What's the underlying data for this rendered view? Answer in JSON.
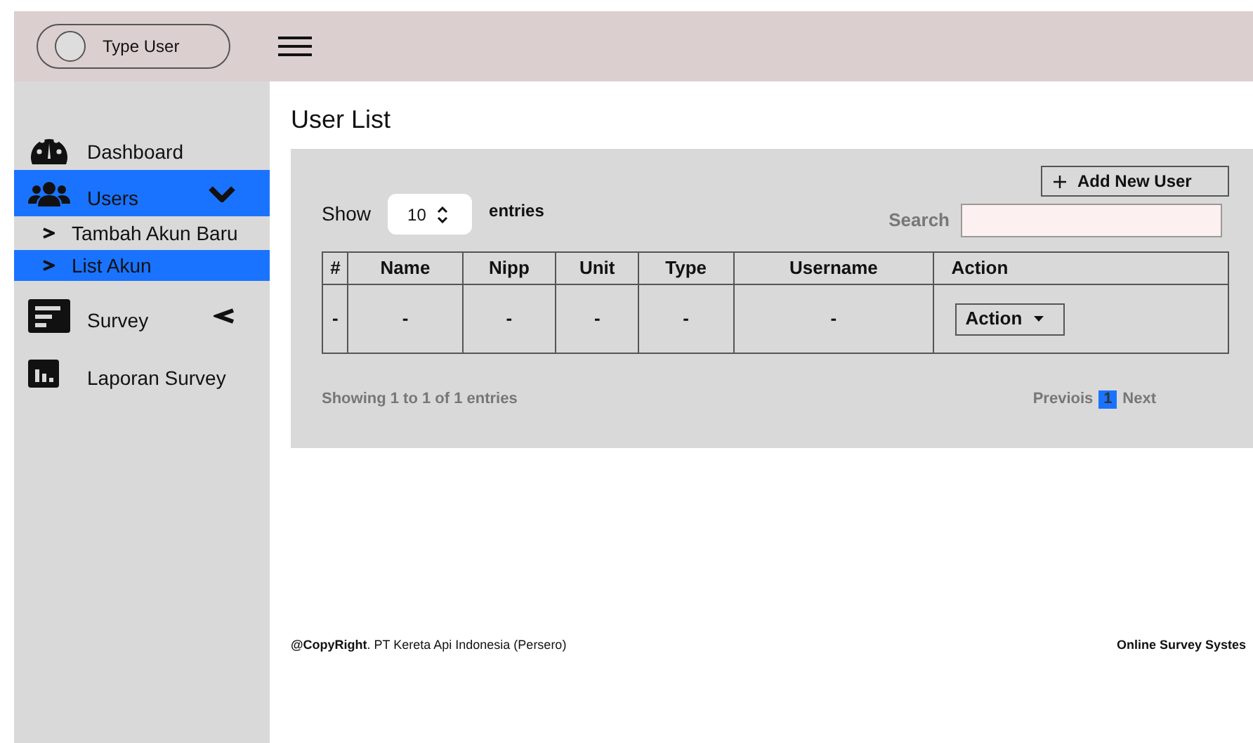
{
  "header": {
    "user_label": "Type User"
  },
  "sidebar": {
    "items": [
      {
        "label": "Dashboard",
        "kind": "dashboard",
        "selected": false
      },
      {
        "label": "Users",
        "kind": "users",
        "selected": true,
        "expanded": true,
        "children": [
          {
            "label": "Tambah Akun Baru",
            "selected": false
          },
          {
            "label": "List Akun",
            "selected": true
          }
        ]
      },
      {
        "label": "Survey",
        "kind": "survey",
        "selected": false,
        "expanded": false
      },
      {
        "label": "Laporan Survey",
        "kind": "report",
        "selected": false
      }
    ]
  },
  "page_title": "User List",
  "add_button": "Add New User",
  "show": {
    "label": "Show",
    "value": "10",
    "suffix": "entries"
  },
  "search": {
    "label": "Search"
  },
  "table": {
    "columns": [
      "#",
      "Name",
      "Nipp",
      "Unit",
      "Type",
      "Username",
      "Action"
    ],
    "rows": [
      {
        "cells": [
          "-",
          "-",
          "-",
          "-",
          "-",
          "-"
        ],
        "action": "Action"
      }
    ]
  },
  "info": "Showing 1 to 1 of 1 entries",
  "pagination": {
    "previous": "Previois",
    "pages": [
      {
        "label": "1",
        "selected": true
      }
    ],
    "next": "Next"
  },
  "footer": {
    "copyright": "**@CopyRight**. PT Kereta Api Indonesia (Persero)",
    "app_name": "Online Survey Systes"
  }
}
